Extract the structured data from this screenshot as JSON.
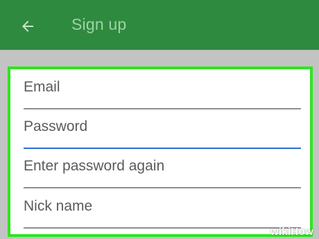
{
  "app_bar": {
    "title": "Sign up",
    "back_icon": "arrow-left-icon",
    "color": "#2e8a3f"
  },
  "form": {
    "highlight_color": "#2ee51f",
    "fields": [
      {
        "label": "Email"
      },
      {
        "label": "Password"
      },
      {
        "label": "Enter password again"
      },
      {
        "label": "Nick name"
      }
    ],
    "focus_color": "#2a6fd1"
  },
  "watermark": {
    "text": "wikiHow"
  }
}
